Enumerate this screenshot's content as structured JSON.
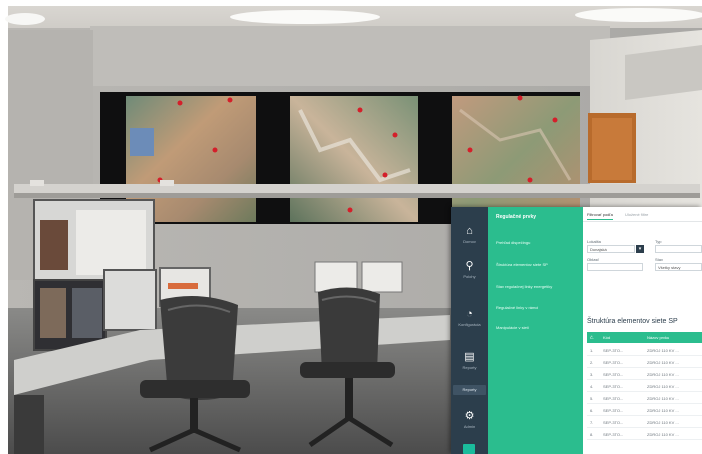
{
  "scene": {
    "description_icons": [
      "ceiling-light",
      "video-wall",
      "office-chair",
      "monitor"
    ]
  },
  "app": {
    "sidebar": {
      "items": [
        {
          "icon": "home-icon",
          "label": "Domov"
        },
        {
          "icon": "pin-icon",
          "label": "Polohy"
        },
        {
          "icon": "chart-icon",
          "label": "Konfigurácia"
        },
        {
          "icon": "document-icon",
          "label": "Reporty"
        },
        {
          "icon": "gear-icon",
          "label": "Admin"
        }
      ],
      "sub_label": "Reporty"
    },
    "menu": {
      "title": "Regulačné prvky",
      "items": [
        "Prehľad dispečingu",
        "Štruktúra elementov siete SP",
        "Stav regulačnej linky energetiky",
        "Regulačné linky v rámci",
        "Manipulácie v sieti"
      ]
    },
    "content": {
      "tabs": [
        "Filtrovať podľa",
        "Uložené filtre"
      ],
      "filters": {
        "label_a": "Lokalita",
        "value_a": "Dunajská",
        "label_b": "Typ",
        "value_b": "",
        "label_c": "Oblasť",
        "value_c": "",
        "label_d": "Stav",
        "value_d": "Všetky stavy"
      },
      "section_title": "Štruktúra elementov siete SP",
      "table": {
        "headers": [
          "Č.",
          "Kód",
          "Názov prvku"
        ],
        "rows": [
          [
            "1.",
            "SEP-3TO...",
            "ZDROJ 110 KV ..."
          ],
          [
            "2.",
            "SEP-3TO...",
            "ZDROJ 110 KV ..."
          ],
          [
            "3.",
            "SEP-3TO...",
            "ZDROJ 110 KV ..."
          ],
          [
            "4.",
            "SEP-3TO...",
            "ZDROJ 110 KV ..."
          ],
          [
            "5.",
            "SEP-3TO...",
            "ZDROJ 110 KV ..."
          ],
          [
            "6.",
            "SEP-3TO...",
            "ZDROJ 110 KV ..."
          ],
          [
            "7.",
            "SEP-3TO...",
            "ZDROJ 110 KV ..."
          ],
          [
            "8.",
            "SEP-3TO...",
            "ZDROJ 110 KV ..."
          ]
        ]
      }
    }
  },
  "colors": {
    "sidebar": "#2c3e4c",
    "accent": "#2bbd8e"
  }
}
